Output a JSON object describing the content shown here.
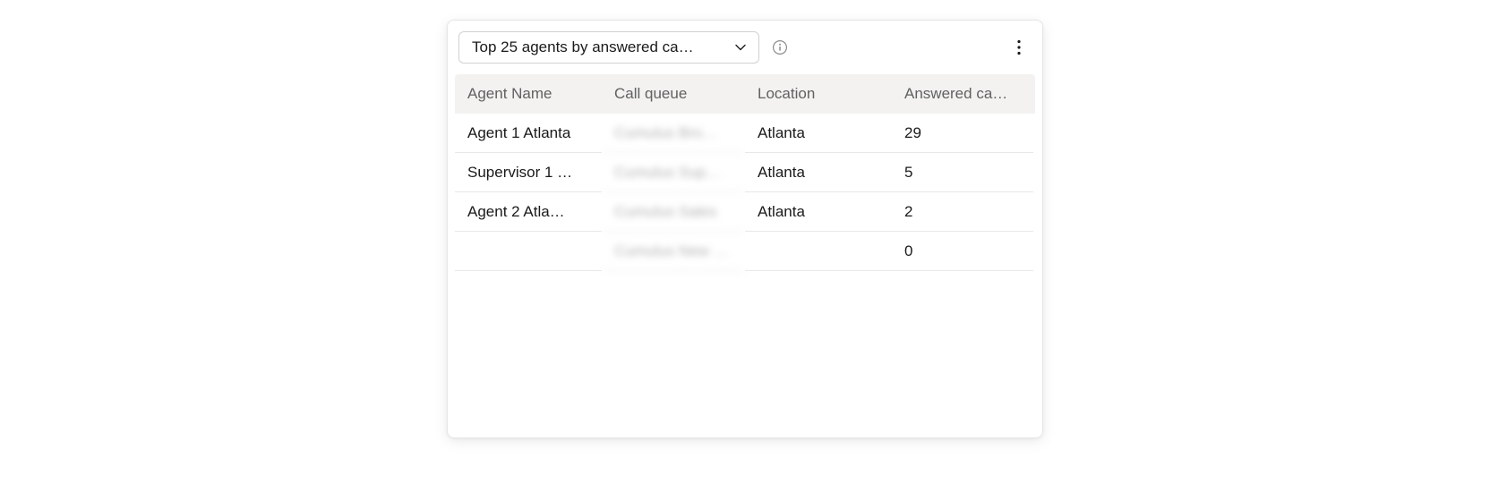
{
  "dropdown": {
    "selected_label": "Top 25 agents by answered ca…"
  },
  "columns": {
    "agent": "Agent Name",
    "queue": "Call queue",
    "location": "Location",
    "answered": "Answered ca…"
  },
  "rows": [
    {
      "agent": "Agent 1 Atlanta",
      "queue": "Cumulus Bro…",
      "location": "Atlanta",
      "answered": "29"
    },
    {
      "agent": "Supervisor 1 …",
      "queue": "Cumulus Sup…",
      "location": "Atlanta",
      "answered": "5"
    },
    {
      "agent": "Agent 2 Atla…",
      "queue": "Cumulus Sales",
      "location": "Atlanta",
      "answered": "2"
    },
    {
      "agent": "",
      "queue": "Cumulus New …",
      "location": "",
      "answered": "0"
    }
  ]
}
